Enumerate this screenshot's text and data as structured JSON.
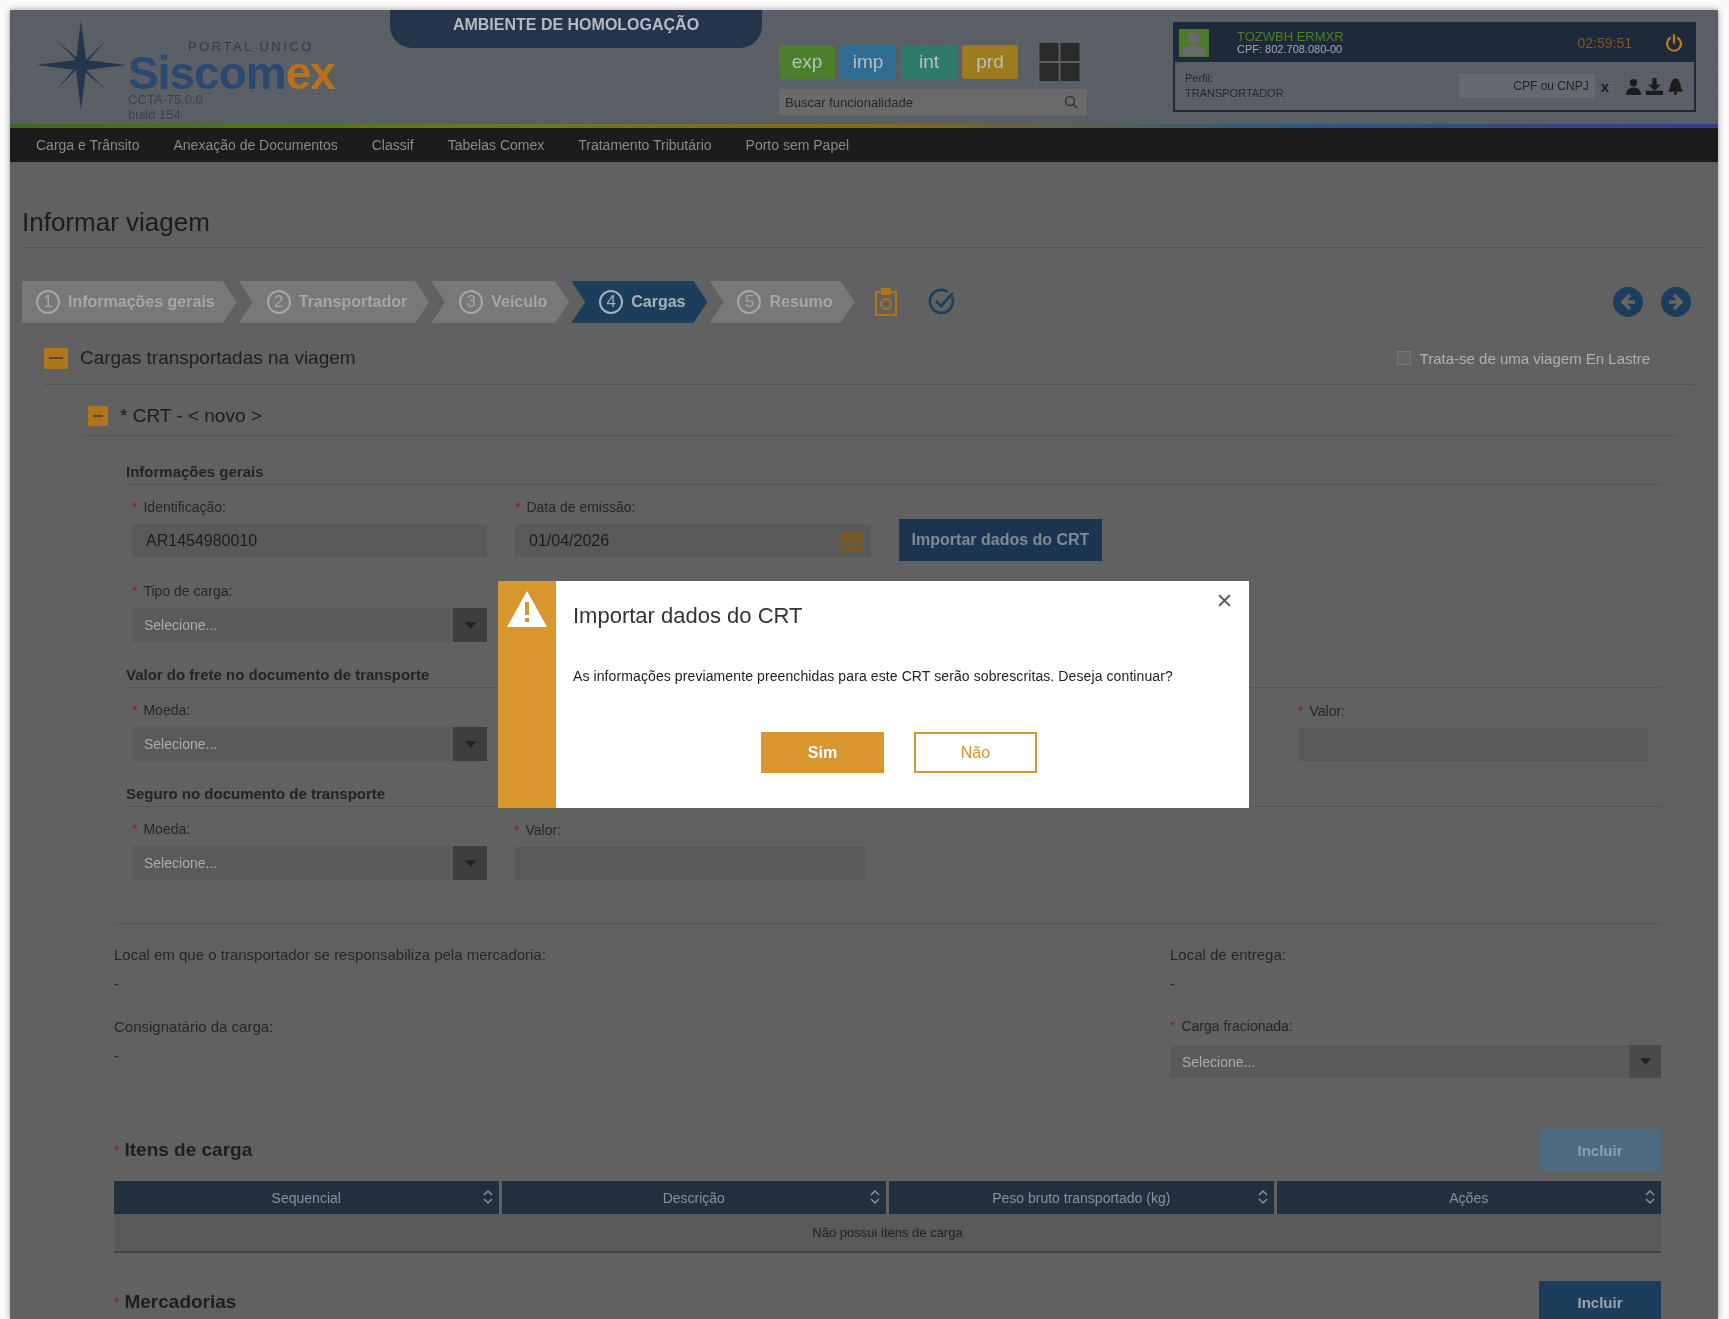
{
  "header": {
    "logo": {
      "tagline": "PORTAL ÚNICO",
      "name_main": "Siscom",
      "name_accent": "ex",
      "version": "CCTA-75.0.0",
      "build": "build 154"
    },
    "environment_banner": "AMBIENTE DE HOMOLOGAÇÃO",
    "environment_buttons": [
      {
        "label": "exp",
        "color": "#4b7f2b"
      },
      {
        "label": "imp",
        "color": "#2f6c94"
      },
      {
        "label": "int",
        "color": "#2e7b6c"
      },
      {
        "label": "prd",
        "color": "#9c7c1c"
      }
    ],
    "search": {
      "placeholder": "Buscar funcionalidade"
    },
    "user": {
      "name": "TOZWBH ERMXR",
      "cpf": "CPF: 802.708.080-00",
      "timer": "02:59:51",
      "profile_label": "Perfil:",
      "profile": "TRANSPORTADOR",
      "cpf_cnpj_field": {
        "placeholder": "CPF ou CNPJ"
      },
      "clear": "x"
    }
  },
  "menu": [
    "Carga e Trânsito",
    "Anexação de Documentos",
    "Classif",
    "Tabelas Comex",
    "Tratamento Tributário",
    "Porto sem Papel"
  ],
  "page_title": "Informar viagem",
  "steps": [
    {
      "number": "1",
      "label": "Informações gerais",
      "selected": false
    },
    {
      "number": "2",
      "label": "Transportador",
      "selected": false
    },
    {
      "number": "3",
      "label": "Veículo",
      "selected": false
    },
    {
      "number": "4",
      "label": "Cargas",
      "selected": true
    },
    {
      "number": "5",
      "label": "Resumo",
      "selected": false
    }
  ],
  "section": {
    "title": "Cargas transportadas na viagem",
    "expanded": true,
    "en_lastre": {
      "label": "Trata-se de uma viagem En Lastre",
      "checked": false
    }
  },
  "crt": {
    "title": "* CRT - < novo >",
    "expanded": true
  },
  "general": {
    "heading": "Informações gerais",
    "identificacao": {
      "mark": "*",
      "label": "Identificação:",
      "value": "AR1454980010"
    },
    "data_emissao": {
      "mark": "*",
      "label": "Data de emissão:",
      "value": "01/04/2026"
    },
    "import_button": "Importar dados do CRT",
    "tipo_carga": {
      "mark": "*",
      "label": "Tipo de carga:",
      "placeholder": "Selecione..."
    }
  },
  "freight": {
    "heading": "Valor do frete no documento de transporte",
    "moeda": {
      "mark": "*",
      "label": "Moeda:",
      "placeholder": "Selecione..."
    },
    "valor": {
      "mark": "*",
      "label": "Valor:"
    }
  },
  "insurance": {
    "heading": "Seguro no documento de transporte",
    "moeda": {
      "mark": "*",
      "label": "Moeda:",
      "placeholder": "Selecione..."
    },
    "valor": {
      "mark": "*",
      "label": "Valor:"
    }
  },
  "details": {
    "responsible_place": {
      "label": "Local em que o transportador se responsabiliza pela mercadoria:",
      "value": "-"
    },
    "delivery_place": {
      "label": "Local de entrega:",
      "value": "-"
    },
    "consignee": {
      "label": "Consignatário da carga:",
      "value": "-"
    },
    "fractioned": {
      "mark": "*",
      "label": "Carga fracionada:",
      "placeholder": "Selecione..."
    }
  },
  "items": {
    "mark": "*",
    "title": "Itens de carga",
    "add_button": {
      "label": "Incluir",
      "disabled": true
    },
    "columns": [
      "Sequencial",
      "Descrição",
      "Peso bruto transportado (kg)",
      "Ações"
    ],
    "empty": "Não possui itens de carga"
  },
  "goods": {
    "mark": "*",
    "title": "Mercadorias",
    "add_button": {
      "label": "Incluir",
      "disabled": false
    }
  },
  "dialog": {
    "title": "Importar dados do CRT",
    "message": "As informações previamente preenchidas para este CRT serão sobrescritas. Deseja continuar?",
    "buttons": [
      {
        "label": "Sim",
        "kind": "primary"
      },
      {
        "label": "Não",
        "kind": "secondary"
      }
    ]
  }
}
